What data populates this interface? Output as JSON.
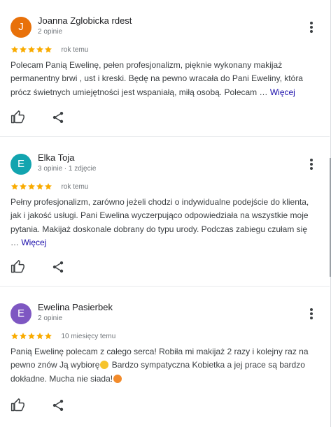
{
  "colors": {
    "star": "#f9ab00",
    "link": "#1a0dab",
    "avatar_orange": "#e8710a",
    "avatar_teal": "#12a4af",
    "avatar_purple": "#7e57c2"
  },
  "icons": {
    "more": "more-vertical-icon",
    "like": "thumbs-up-icon",
    "share": "share-icon",
    "star": "star-icon"
  },
  "reviews": [
    {
      "avatar_letter": "J",
      "avatar_color": "#e8710a",
      "name": "Joanna Zglobicka rdest",
      "meta": "2 opinie",
      "stars": 5,
      "date": "rok temu",
      "text": "Polecam Panią Ewelinę, pełen profesjonalizm, pięknie wykonany makijaż permanentny brwi , ust i kreski. Będę na pewno wracała do Pani Eweliny, która prócz świetnych umiejętności jest wspaniałą, miłą osobą. Polecam … ",
      "more_link": "Więcej"
    },
    {
      "avatar_letter": "E",
      "avatar_color": "#12a4af",
      "name": "Elka Toja",
      "meta": "3 opinie · 1 zdjęcie",
      "stars": 5,
      "date": "rok temu",
      "text": "Pełny profesjonalizm, zarówno jeżeli chodzi o indywidualne podejście do klienta, jak i jakość usługi. Pani Ewelina wyczerpująco odpowiedziała na wszystkie moje pytania. Makijaż doskonale dobrany do typu urody. Podczas zabiegu czułam się … ",
      "more_link": "Więcej"
    },
    {
      "avatar_letter": "E",
      "avatar_color": "#7e57c2",
      "name": "Ewelina Pasierbek",
      "meta": "2 opinie",
      "stars": 5,
      "date": "10 miesięcy temu",
      "text_part1": "Panią Ewelinę polecam z całego serca! Robiła mi makijaż 2 razy i kolejny raz na pewno znów Ją wybiorę",
      "emoji1": "smiling-face-emoji",
      "text_part2": " Bardzo sympatyczna Kobietka a jej prace są bardzo dokładne. Mucha nie siada!",
      "emoji2": "face-blowing-kiss-emoji"
    }
  ]
}
